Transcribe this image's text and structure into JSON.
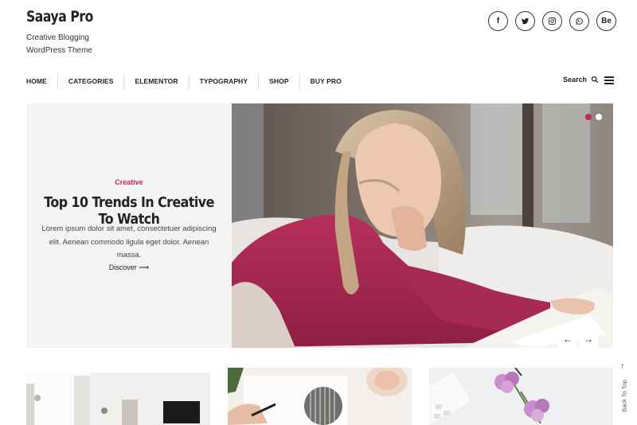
{
  "site": {
    "title": "Saaya Pro",
    "description": "Creative Blogging WordPress Theme"
  },
  "social": [
    {
      "icon": "facebook-icon",
      "glyph": "f"
    },
    {
      "icon": "twitter-icon",
      "glyph": ""
    },
    {
      "icon": "instagram-icon",
      "glyph": ""
    },
    {
      "icon": "whatsapp-icon",
      "glyph": ""
    },
    {
      "icon": "behance-icon",
      "glyph": "Be"
    }
  ],
  "nav": {
    "items": [
      "HOME",
      "CATEGORIES",
      "ELEMENTOR",
      "TYPOGRAPHY",
      "SHOP",
      "BUY PRO"
    ]
  },
  "search": {
    "label": "Search"
  },
  "slider": {
    "category": "Creative",
    "title": "Top 10 Trends In Creative To Watch",
    "excerpt": "Lorem ipsum dolor sit amet, consectetuer adipiscing elit. Aenean commodo ligula eget dolor. Aenean massa.",
    "discover": "Discover ⟶",
    "arrow_prev": "←",
    "arrow_next": "→"
  },
  "back_to_top": {
    "label": "Back To Top",
    "arrow": "↑"
  },
  "colors": {
    "accent": "#d0245e",
    "text": "#222222",
    "panel": "#f4f4f4"
  }
}
